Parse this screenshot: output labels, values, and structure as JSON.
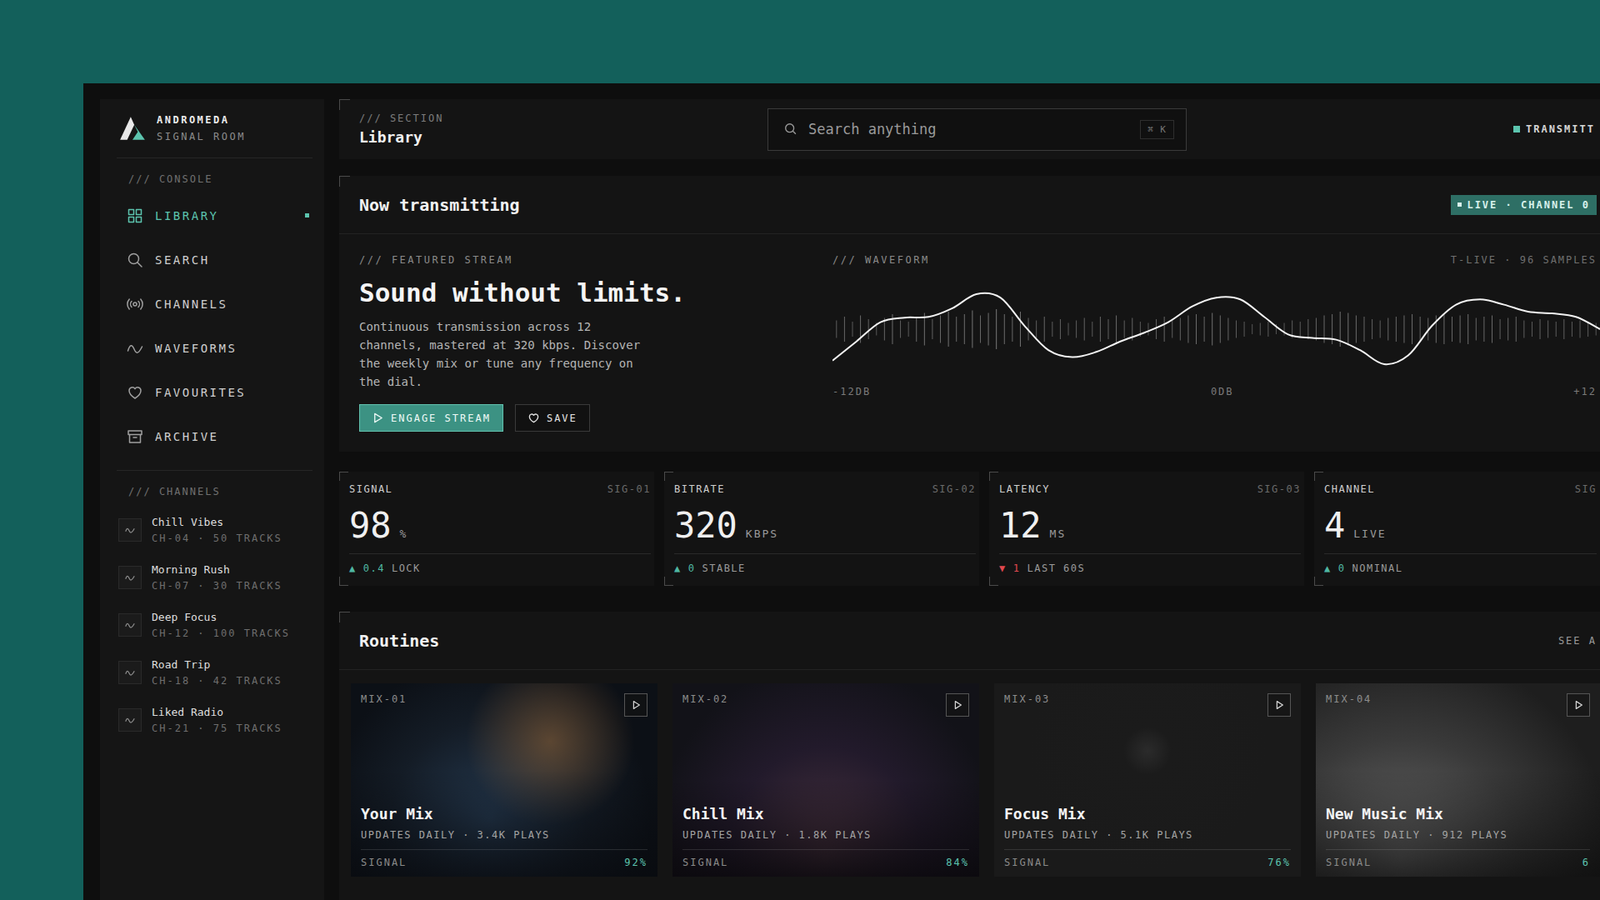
{
  "window": {
    "brand": "ANDROMEDA",
    "subtitle": "SIGNAL ROOM"
  },
  "sidebar": {
    "console_label": "/// CONSOLE",
    "items": [
      {
        "label": "LIBRARY",
        "selected": true
      },
      {
        "label": "SEARCH",
        "selected": false
      },
      {
        "label": "CHANNELS",
        "selected": false
      },
      {
        "label": "WAVEFORMS",
        "selected": false
      },
      {
        "label": "FAVOURITES",
        "selected": false
      },
      {
        "label": "ARCHIVE",
        "selected": false
      }
    ],
    "channels_label": "/// CHANNELS",
    "channels": [
      {
        "name": "Chill Vibes",
        "meta": "CH-04 · 50 TRACKS"
      },
      {
        "name": "Morning Rush",
        "meta": "CH-07 · 30 TRACKS"
      },
      {
        "name": "Deep Focus",
        "meta": "CH-12 · 100 TRACKS"
      },
      {
        "name": "Road Trip",
        "meta": "CH-18 · 42 TRACKS"
      },
      {
        "name": "Liked Radio",
        "meta": "CH-21 · 75 TRACKS"
      }
    ]
  },
  "header": {
    "section_label": "/// SECTION",
    "title": "Library",
    "search": {
      "placeholder": "Search anything",
      "shortcut": "⌘ K"
    },
    "status": "TRANSMITT"
  },
  "hero": {
    "title": "Now transmitting",
    "badge": "LIVE · CHANNEL 0",
    "kicker": "/// FEATURED STREAM",
    "heading": "Sound without limits.",
    "description": "Continuous transmission across 12 channels, mastered at 320 kbps. Discover the weekly mix or tune any frequency on the dial.",
    "buttons": [
      {
        "label": "ENGAGE STREAM",
        "kind": "primary"
      },
      {
        "label": "SAVE",
        "kind": "secondary"
      }
    ]
  },
  "waveform": {
    "label": "/// WAVEFORM",
    "meta": "T-LIVE · 96 SAMPLES",
    "axis": [
      "-12DB",
      "0DB",
      "+12"
    ],
    "curve": [
      -0.9,
      -0.35,
      0.2,
      0.33,
      0.35,
      0.6,
      1.0,
      0.9,
      0.1,
      -0.6,
      -0.8,
      -0.65,
      -0.35,
      -0.1,
      0.2,
      0.65,
      0.9,
      0.85,
      0.35,
      -0.15,
      -0.25,
      -0.3,
      -0.6,
      -1.0,
      -0.75,
      0.1,
      0.7,
      0.85,
      0.7,
      0.5,
      0.45,
      0.35,
      0.0
    ],
    "samples": [
      0.35,
      0.5,
      0.3,
      0.55,
      0.4,
      0.25,
      0.45,
      0.6,
      0.35,
      0.3,
      0.5,
      0.65,
      0.4,
      0.55,
      0.7,
      0.5,
      0.6,
      0.75,
      0.55,
      0.65,
      0.8,
      0.6,
      0.5,
      0.7,
      0.45,
      0.35,
      0.5,
      0.3,
      0.4,
      0.25,
      0.35,
      0.45,
      0.3,
      0.5,
      0.4,
      0.55,
      0.35,
      0.45,
      0.3,
      0.25,
      0.4,
      0.5,
      0.35,
      0.45,
      0.55,
      0.6,
      0.5,
      0.65,
      0.55,
      0.45,
      0.35,
      0.3,
      0.2,
      0.25,
      0.3,
      0.2,
      0.25,
      0.35,
      0.3,
      0.4,
      0.45,
      0.55,
      0.6,
      0.7,
      0.65,
      0.55,
      0.5,
      0.4,
      0.35,
      0.45,
      0.5,
      0.55,
      0.6,
      0.5,
      0.45,
      0.55,
      0.6,
      0.5,
      0.55,
      0.6,
      0.45,
      0.5,
      0.55,
      0.4,
      0.45,
      0.5,
      0.35,
      0.3,
      0.4,
      0.35,
      0.3,
      0.4,
      0.3,
      0.35,
      0.3,
      0.25
    ]
  },
  "stats": [
    {
      "label": "SIGNAL",
      "code": "SIG-01",
      "value": "98",
      "unit": "%",
      "arrow": "▲",
      "delta": "0.4",
      "note": "LOCK",
      "color": "#4fb8a3"
    },
    {
      "label": "BITRATE",
      "code": "SIG-02",
      "value": "320",
      "unit": "KBPS",
      "arrow": "▲",
      "delta": "0",
      "note": "STABLE",
      "color": "#4fb8a3"
    },
    {
      "label": "LATENCY",
      "code": "SIG-03",
      "value": "12",
      "unit": "MS",
      "arrow": "▼",
      "delta": "1",
      "note": "LAST 60S",
      "color": "#e0484f"
    },
    {
      "label": "CHANNEL",
      "code": "SIG",
      "value": "4",
      "unit": "LIVE",
      "arrow": "▲",
      "delta": "0",
      "note": "NOMINAL",
      "color": "#4fb8a3"
    }
  ],
  "routines": {
    "title": "Routines",
    "link": "SEE A",
    "cards": [
      {
        "code": "MIX-01",
        "title": "Your Mix",
        "meta": "UPDATES DAILY · 3.4K PLAYS",
        "signal_label": "SIGNAL",
        "signal": "92%"
      },
      {
        "code": "MIX-02",
        "title": "Chill Mix",
        "meta": "UPDATES DAILY · 1.8K PLAYS",
        "signal_label": "SIGNAL",
        "signal": "84%"
      },
      {
        "code": "MIX-03",
        "title": "Focus Mix",
        "meta": "UPDATES DAILY · 5.1K PLAYS",
        "signal_label": "SIGNAL",
        "signal": "76%"
      },
      {
        "code": "MIX-04",
        "title": "New Music Mix",
        "meta": "UPDATES DAILY · 912 PLAYS",
        "signal_label": "SIGNAL",
        "signal": "6"
      }
    ]
  }
}
